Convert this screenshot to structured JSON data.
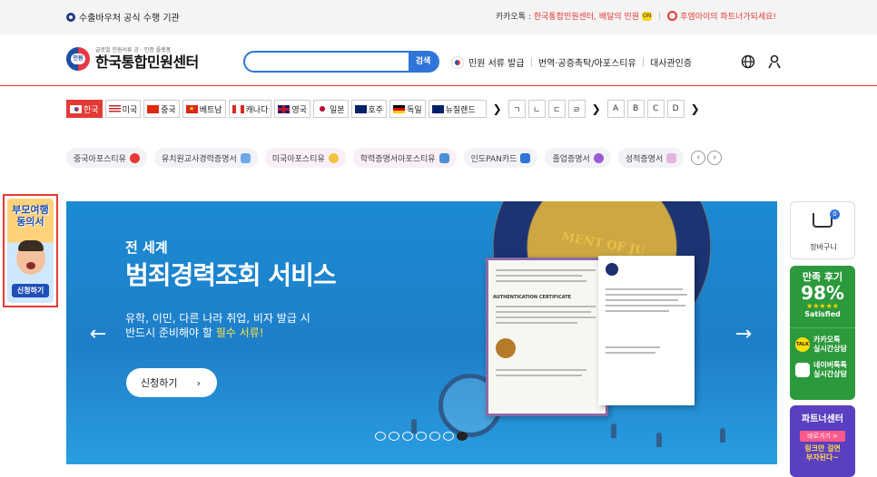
{
  "topbar": {
    "left_text": "수출바우처 공식 수행 기관",
    "kakao_prefix": "카카오톡 : ",
    "kakao_channel": "한국통합민원센터, 배달의 민원",
    "kakao_chip": "ON",
    "promo": "후엠아이의 파트너가되세요!"
  },
  "header": {
    "logo_mark": "민원",
    "logo_tagline": "글로벌 민원서류 공 · 인증 플랫폼",
    "logo_title": "한국통합민원센터",
    "search_placeholder": "",
    "search_button": "검색",
    "nav": [
      "민원 서류 발급",
      "번역·공증촉탁/아포스티유",
      "대사관인증"
    ],
    "globe_icon": "globe-icon",
    "user_icon": "user-icon",
    "accent_color": "#2f74d8",
    "divider_color": "#e53935"
  },
  "countries": {
    "items": [
      {
        "label": "한국",
        "active": true
      },
      {
        "label": "미국",
        "active": false
      },
      {
        "label": "중국",
        "active": false
      },
      {
        "label": "베트남",
        "active": false
      },
      {
        "label": "캐나다",
        "active": false
      },
      {
        "label": "영국",
        "active": false
      },
      {
        "label": "일본",
        "active": false
      },
      {
        "label": "호주",
        "active": false
      },
      {
        "label": "독일",
        "active": false
      },
      {
        "label": "뉴질랜드",
        "active": false
      }
    ],
    "next_arrow": "❯",
    "korean_letters": [
      "ㄱ",
      "ㄴ",
      "ㄷ",
      "ㄹ"
    ],
    "letters_next": "❯",
    "latin_letters": [
      "A",
      "B",
      "C",
      "D"
    ],
    "latin_next": "❯"
  },
  "services": {
    "items": [
      "중국아포스티유",
      "유치원교사경력증명서",
      "미국아포스티유",
      "학력증명서아포스티유",
      "인도PAN카드",
      "졸업증명서",
      "성적증명서"
    ],
    "prev": "‹",
    "next": "›"
  },
  "left_banner": {
    "title_line1": "부모여행",
    "title_line2": "동의서",
    "button": "신청하기"
  },
  "hero": {
    "subtitle": "전 세계",
    "title": "범죄경력조회 서비스",
    "desc_line1": "유학, 이민, 다른 나라 취업, 비자 발급 시",
    "desc_line2_a": "반드시 준비해야 할 ",
    "desc_line2_b": "필수 서류!",
    "cta_label": "신청하기",
    "cta_arrow": "›",
    "prev_arrow": "←",
    "next_arrow": "→",
    "seal_text": "MENT OF JU",
    "doc_caption": "AUTHENTICATION CERTIFICATE",
    "slide_count": 7,
    "active_slide": 7
  },
  "right_rail": {
    "cart_badge": "0",
    "cart_label": "장바구니",
    "review_top": "만족 후기",
    "review_pct": "98%",
    "review_stars": "★★★★★",
    "review_bottom": "Satisfied",
    "kakao_icon_text": "TALK",
    "kakao_line1": "카카오톡",
    "kakao_line2": "실시간상담",
    "naver_line1": "네이버톡톡",
    "naver_line2": "실시간상담",
    "partner_title": "파트너센터",
    "partner_button": "바로가기 >",
    "partner_line1": "링크만 걸면",
    "partner_line2": "부자된다~"
  }
}
